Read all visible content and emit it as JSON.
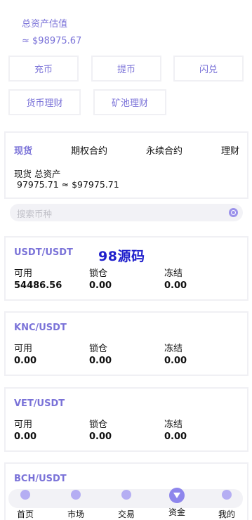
{
  "summary": {
    "title": "总资产估值",
    "value": "≈ $98975.67"
  },
  "actions": [
    "充币",
    "提币",
    "闪兑",
    "货币理财",
    "矿池理财"
  ],
  "tabs": [
    "现货",
    "期权合约",
    "永续合约",
    "理财"
  ],
  "total": {
    "label": "现货 总资产",
    "value": "97975.71 ≈ $97975.71"
  },
  "search": {
    "placeholder": "搜索币种"
  },
  "columns": [
    "可用",
    "锁仓",
    "冻结"
  ],
  "assets": [
    {
      "pair": "USDT/USDT",
      "available": "54486.56",
      "locked": "0.00",
      "frozen": "0.00"
    },
    {
      "pair": "KNC/USDT",
      "available": "0.00",
      "locked": "0.00",
      "frozen": "0.00"
    },
    {
      "pair": "VET/USDT",
      "available": "0.00",
      "locked": "0.00",
      "frozen": "0.00"
    },
    {
      "pair": "BCH/USDT"
    }
  ],
  "watermark": "98源码",
  "nav": [
    {
      "label": "首页",
      "icon": "home-icon"
    },
    {
      "label": "市场",
      "icon": "market-chart-icon"
    },
    {
      "label": "交易",
      "icon": "trade-icon"
    },
    {
      "label": "资金",
      "icon": "wallet-icon",
      "active": true
    },
    {
      "label": "我的",
      "icon": "user-icon"
    }
  ],
  "colors": {
    "accent": "#7a72d8",
    "active_nav": "#8e86ec",
    "border": "#f0f0f4"
  }
}
